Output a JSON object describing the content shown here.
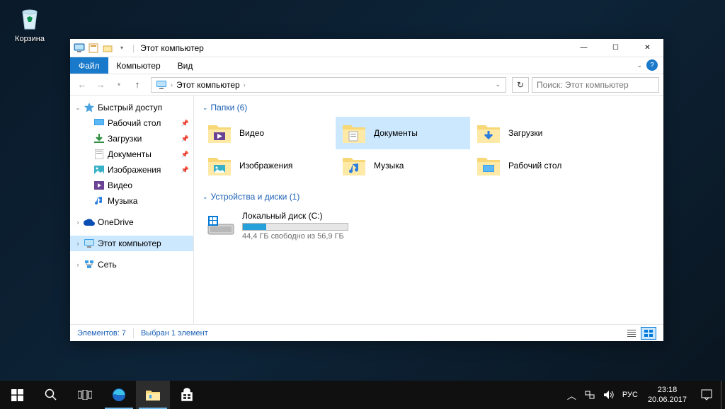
{
  "desktop": {
    "recycle_bin": "Корзина"
  },
  "window": {
    "title": "Этот компьютер",
    "controls": {
      "min": "—",
      "max": "☐",
      "close": "✕"
    }
  },
  "ribbon": {
    "file": "Файл",
    "tabs": [
      "Компьютер",
      "Вид"
    ]
  },
  "nav": {
    "back": "←",
    "forward": "→",
    "up": "↑",
    "address_root": "Этот компьютер",
    "search_placeholder": "Поиск: Этот компьютер",
    "refresh": "↻"
  },
  "sidebar": {
    "quick_access": "Быстрый доступ",
    "quick_items": [
      {
        "label": "Рабочий стол"
      },
      {
        "label": "Загрузки"
      },
      {
        "label": "Документы"
      },
      {
        "label": "Изображения"
      },
      {
        "label": "Видео"
      },
      {
        "label": "Музыка"
      }
    ],
    "onedrive": "OneDrive",
    "this_pc": "Этот компьютер",
    "network": "Сеть"
  },
  "content": {
    "folders_header": "Папки (6)",
    "folders": [
      {
        "label": "Видео"
      },
      {
        "label": "Документы"
      },
      {
        "label": "Загрузки"
      },
      {
        "label": "Изображения"
      },
      {
        "label": "Музыка"
      },
      {
        "label": "Рабочий стол"
      }
    ],
    "devices_header": "Устройства и диски (1)",
    "drive": {
      "name": "Локальный диск (C:)",
      "free_text": "44,4 ГБ свободно из 56,9 ГБ",
      "used_percent": 22
    }
  },
  "status": {
    "items": "Элементов: 7",
    "selected": "Выбран 1 элемент"
  },
  "taskbar": {
    "lang": "РУС",
    "time": "23:18",
    "date": "20.06.2017"
  }
}
